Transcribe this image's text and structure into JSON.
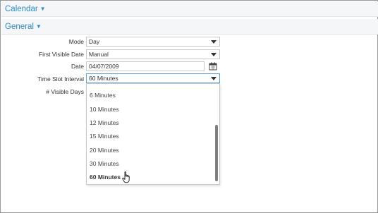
{
  "sections": {
    "calendar": {
      "label": "Calendar"
    },
    "general": {
      "label": "General"
    }
  },
  "form": {
    "mode": {
      "label": "Mode",
      "value": "Day"
    },
    "first_visible_date": {
      "label": "First Visible Date",
      "value": "Manual"
    },
    "date": {
      "label": "Date",
      "value": "04/07/2009"
    },
    "time_slot_interval": {
      "label": "Time Slot Interval",
      "value": "60 Minutes"
    },
    "visible_days": {
      "label": "# Visible Days"
    }
  },
  "dropdown": {
    "options": [
      "6 Minutes",
      "10 Minutes",
      "12 Minutes",
      "15 Minutes",
      "20 Minutes",
      "30 Minutes",
      "60 Minutes"
    ],
    "selected": "60 Minutes"
  },
  "colors": {
    "accent": "#2b8bc6",
    "header_bg": "#f5f6f7",
    "focus_border": "#5aa4d9"
  },
  "icons": [
    "caret-down-icon",
    "calendar-icon",
    "hand-cursor-icon"
  ]
}
